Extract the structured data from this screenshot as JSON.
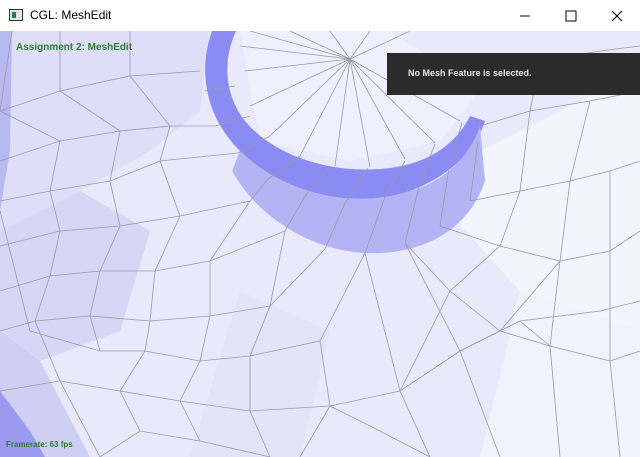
{
  "window": {
    "title": "CGL: MeshEdit",
    "icon": "app-window-icon",
    "controls": [
      "minimize-icon",
      "maximize-icon",
      "close-icon"
    ]
  },
  "overlay": {
    "assignment_label": "Assignment 2: MeshEdit",
    "info_panel_text": "No Mesh Feature is selected.",
    "framerate_text": "Framerate: 63 fps"
  },
  "colors": {
    "label_green": "#2e7d32",
    "panel_bg": "#2b2b2b",
    "mesh_edge": "#9a9aa6",
    "mesh_light": "#eeeeff",
    "mesh_dark": "#8080f0"
  }
}
